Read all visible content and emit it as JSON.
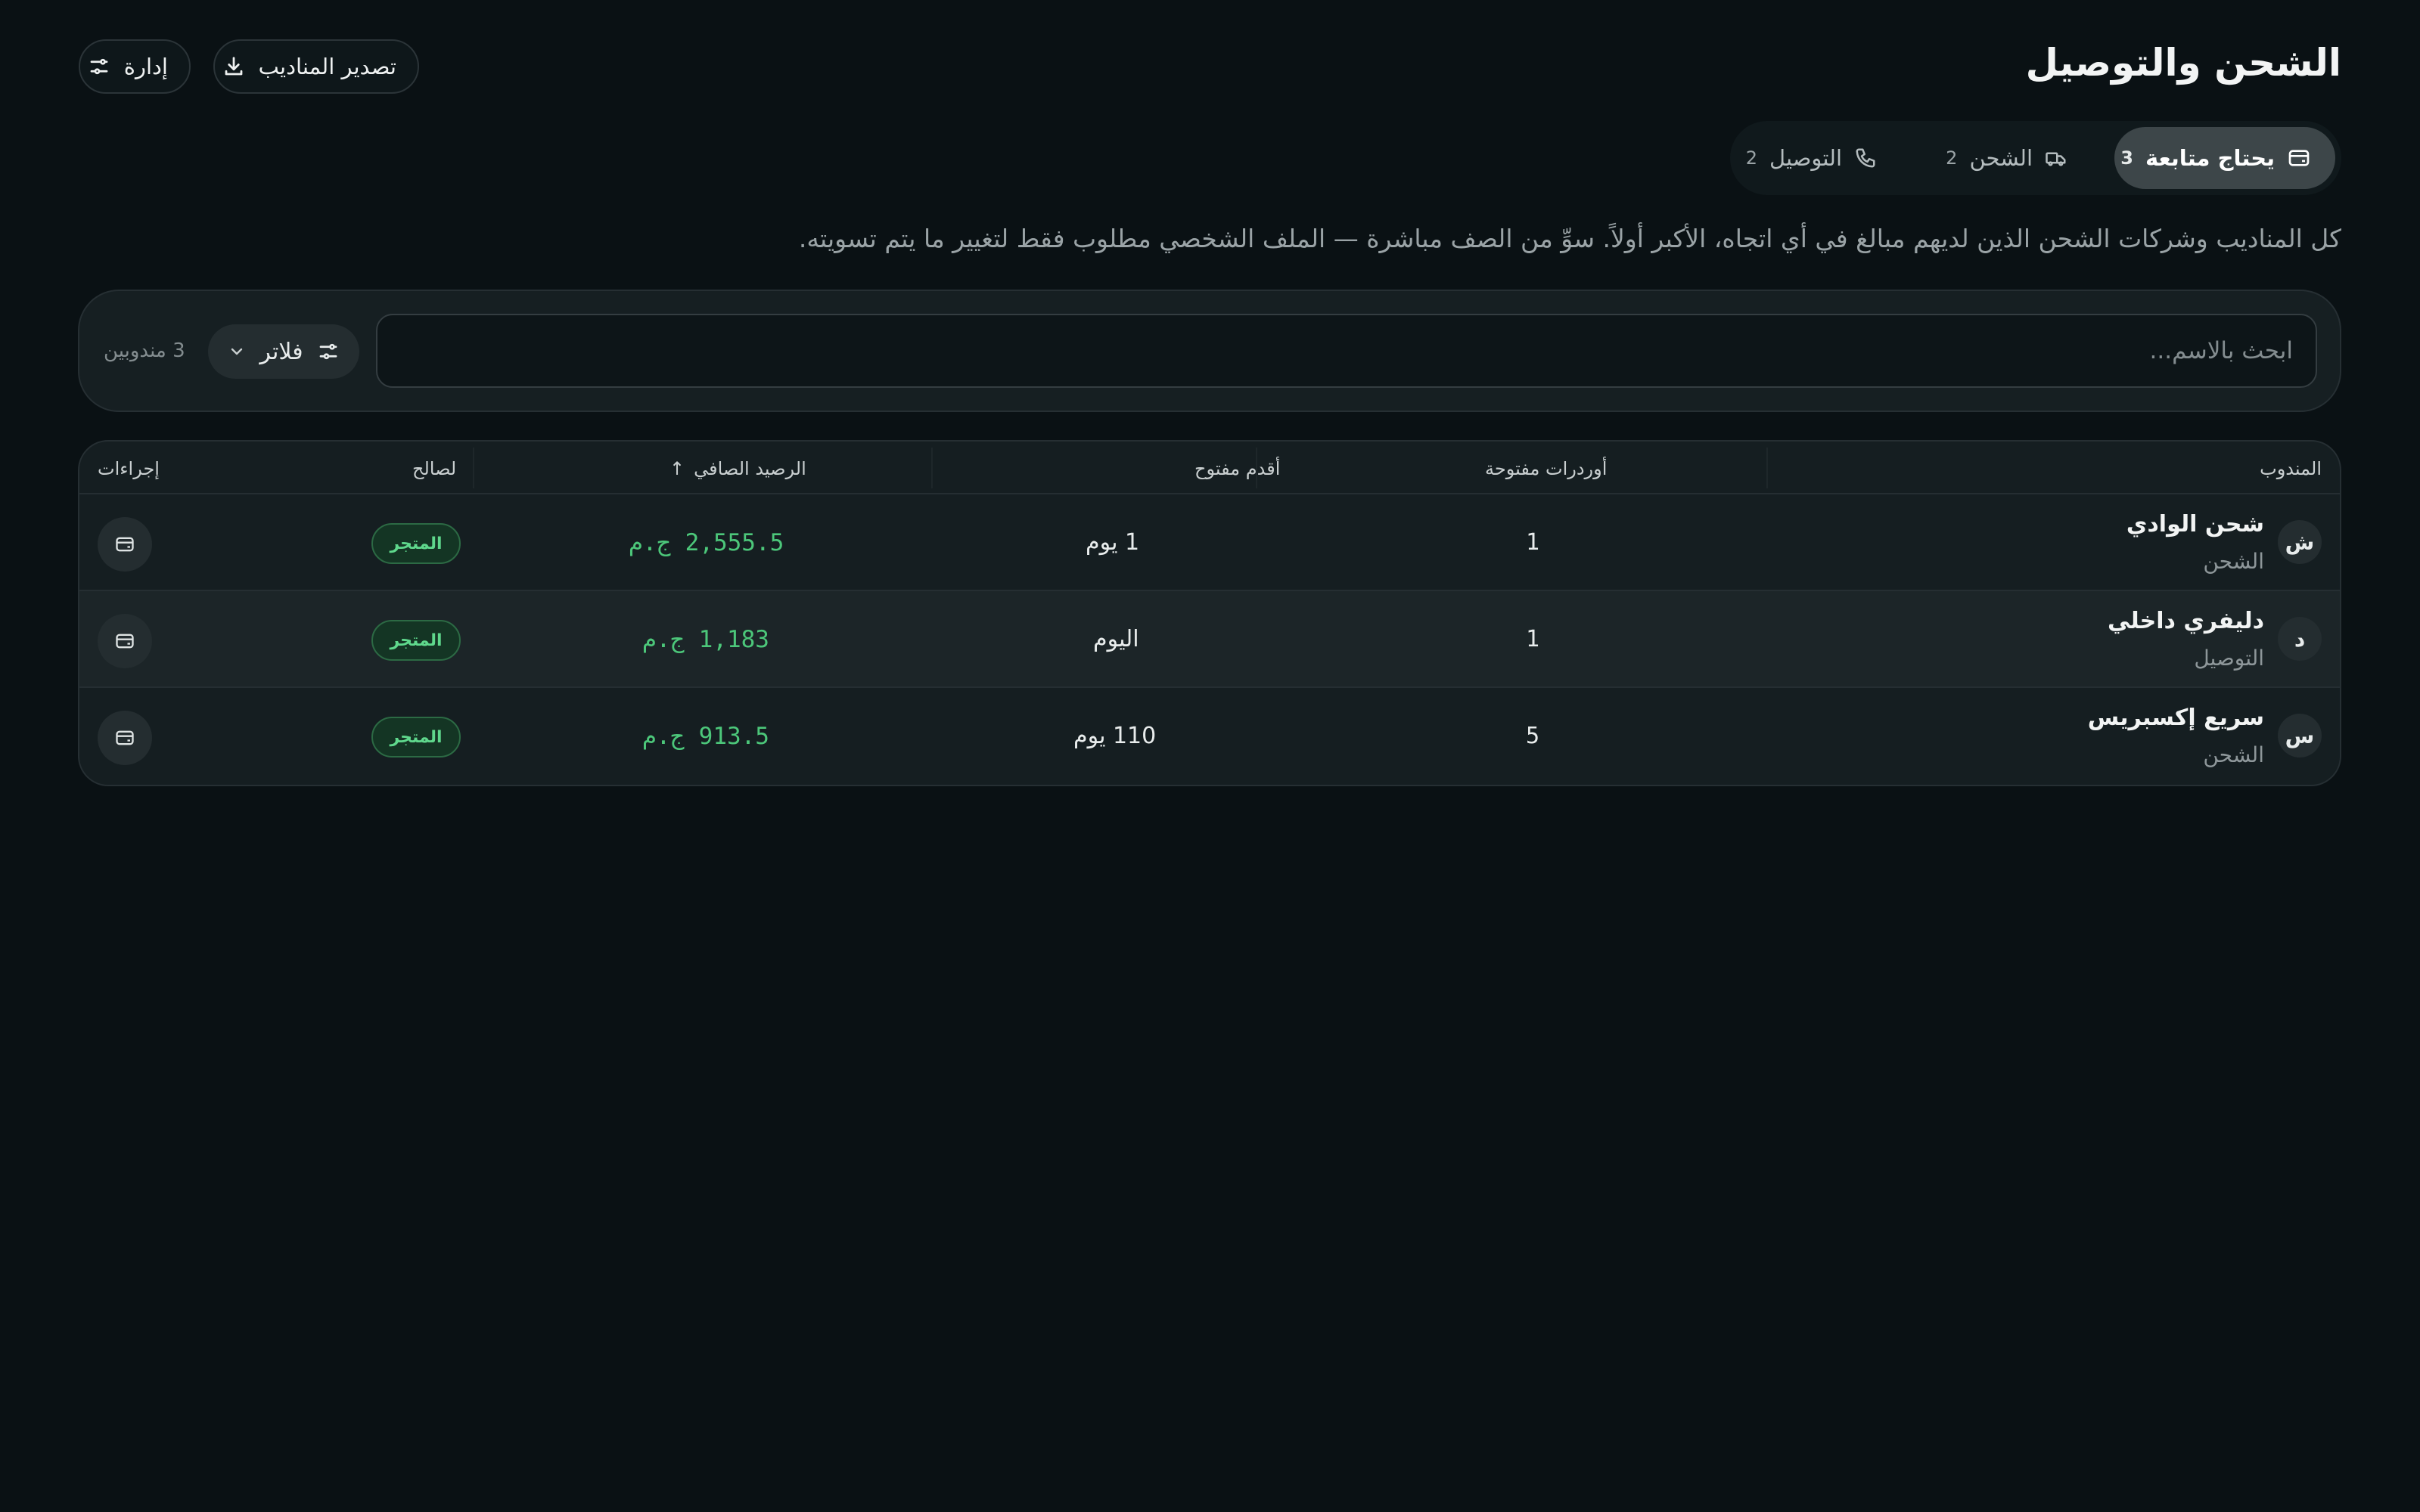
{
  "header": {
    "title": "الشحن والتوصيل",
    "export_label": "تصدير المناديب",
    "manage_label": "إدارة"
  },
  "tabs": [
    {
      "label": "يحتاج متابعة",
      "count": "3",
      "icon": "wallet-icon",
      "active": true
    },
    {
      "label": "الشحن",
      "count": "2",
      "icon": "truck-icon",
      "active": false
    },
    {
      "label": "التوصيل",
      "count": "2",
      "icon": "phone-icon",
      "active": false
    }
  ],
  "description": "كل المناديب وشركات الشحن الذين لديهم مبالغ في أي اتجاه، الأكبر أولاً. سوِّ من الصف مباشرة — الملف الشخصي مطلوب فقط لتغيير ما يتم تسويته.",
  "filters": {
    "search_placeholder": "ابحث بالاسم...",
    "filter_label": "فلاتر",
    "agents_count": "3 مندوبين"
  },
  "table": {
    "columns": {
      "agent": "المندوب",
      "open_orders": "أوردرات مفتوحة",
      "oldest_open": "أقدم مفتوح",
      "net_balance": "الرصيد الصافي",
      "sort_indicator": "↑",
      "in_favor_of": "لصالح",
      "actions": "إجراءات"
    },
    "rows": [
      {
        "initial": "ش",
        "name": "شحن الوادي",
        "type": "الشحن",
        "open_orders": "1",
        "oldest_open": "1 يوم",
        "balance": "2,555.5 ج.م",
        "in_favor": "المتجر"
      },
      {
        "initial": "د",
        "name": "دليفري داخلي",
        "type": "التوصيل",
        "open_orders": "1",
        "oldest_open": "اليوم",
        "balance": "1,183 ج.م",
        "in_favor": "المتجر"
      },
      {
        "initial": "س",
        "name": "سريع إكسبريس",
        "type": "الشحن",
        "open_orders": "5",
        "oldest_open": "110 يوم",
        "balance": "913.5 ج.م",
        "in_favor": "المتجر"
      }
    ]
  },
  "colors": {
    "background": "#0a1114",
    "accent_green": "#4cc77a",
    "badge_green": "#5fd88c"
  }
}
